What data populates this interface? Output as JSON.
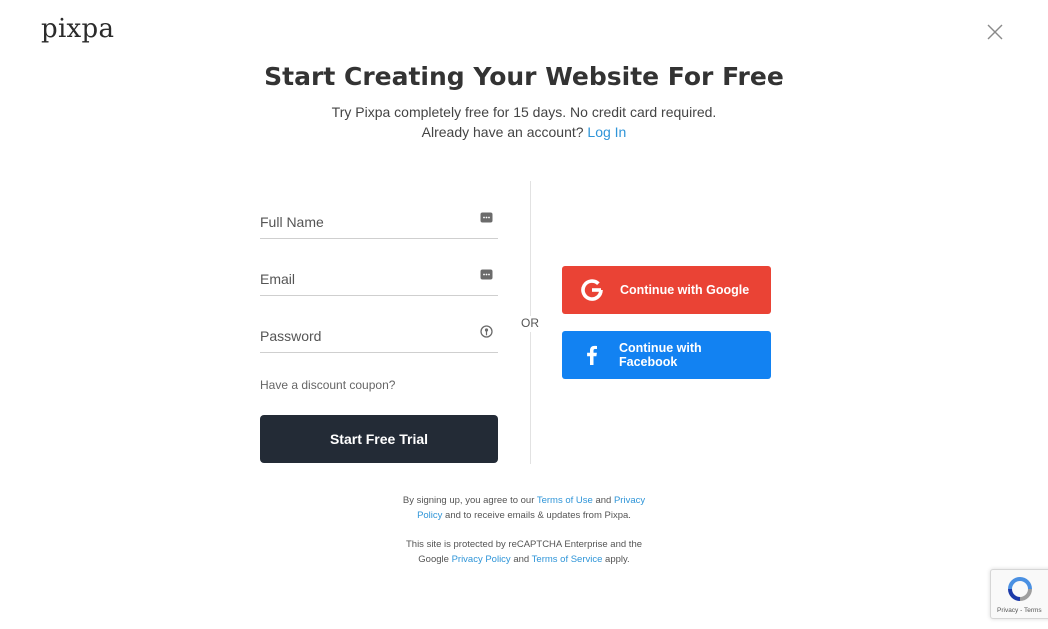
{
  "brand": {
    "logo_text": "pixpa"
  },
  "heading": {
    "title": "Start Creating Your Website For Free",
    "subtitle": "Try Pixpa completely free for 15 days. No credit card required.",
    "login_prompt": "Already have an account?",
    "login_link": "Log In"
  },
  "form": {
    "full_name": {
      "placeholder": "Full Name",
      "value": ""
    },
    "email": {
      "placeholder": "Email",
      "value": ""
    },
    "password": {
      "placeholder": "Password",
      "value": ""
    },
    "coupon_link": "Have a discount coupon?",
    "submit_label": "Start Free Trial"
  },
  "divider": {
    "or_label": "OR"
  },
  "social": {
    "google_label": "Continue with Google",
    "facebook_line1": "Continue with",
    "facebook_line2": "Facebook"
  },
  "legal": {
    "line1_prefix": "By signing up, you agree to our",
    "terms_of_use": "Terms of Use",
    "and1": "and",
    "privacy_policy_1": "Privacy Policy",
    "line1_suffix": "and to receive emails & updates from Pixpa.",
    "line2_prefix": "This site is protected by reCAPTCHA Enterprise and the Google",
    "privacy_policy_2": "Privacy Policy",
    "and2": "and",
    "terms_of_service": "Terms of Service",
    "line2_suffix": "apply."
  },
  "recaptcha": {
    "footer_text": "Privacy - Terms"
  },
  "icons": {
    "close": "close-icon",
    "field_autofill": "autofill-icon",
    "password_key": "key-icon",
    "google": "google-icon",
    "facebook": "facebook-icon",
    "recaptcha": "recaptcha-icon"
  },
  "colors": {
    "google_button": "#ea4335",
    "facebook_button": "#1282f2",
    "primary_button": "#232b36",
    "link": "#2f95d8"
  }
}
